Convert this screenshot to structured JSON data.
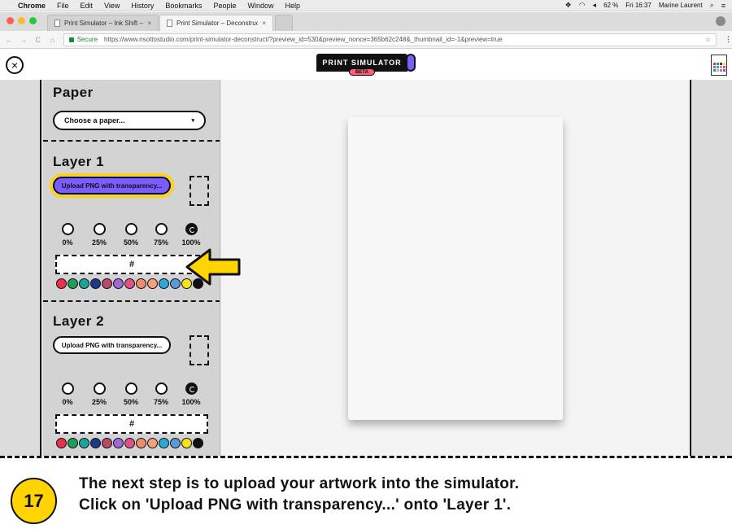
{
  "os_menubar": {
    "app": "Chrome",
    "menus": [
      "File",
      "Edit",
      "View",
      "History",
      "Bookmarks",
      "People",
      "Window",
      "Help"
    ],
    "battery": "62 %",
    "clock": "Fri 16:37",
    "user": "Marine Laurent"
  },
  "browser": {
    "tabs": [
      {
        "title": "Print Simulator – Ink Shift – Ri",
        "close": "×"
      },
      {
        "title": "Print Simulator – Deconstruct",
        "close": "×"
      }
    ],
    "secure_label": "Secure",
    "url": "https://www.risottostudio.com/print-simulator-deconstruct/?preview_id=530&preview_nonce=365b62c248&_thumbnail_id=-1&preview=true",
    "nav": {
      "back": "←",
      "forward": "→",
      "reload": "C",
      "home": "⌂"
    },
    "star": "☆",
    "menu": "⋮"
  },
  "app_header": {
    "close_glyph": "×",
    "logo_title": "PRINT SIMULATOR",
    "logo_badge": "BETA"
  },
  "sidebar": {
    "paper": {
      "title": "Paper",
      "select_value": "Choose a paper...",
      "chevron": "▾"
    },
    "layers": [
      {
        "title": "Layer 1",
        "upload_label": "Upload PNG with transparency...",
        "opacity_options": [
          "0%",
          "25%",
          "50%",
          "75%",
          "100%"
        ],
        "selected_opacity": "100%",
        "hex_placeholder": "#"
      },
      {
        "title": "Layer 2",
        "upload_label": "Upload PNG with transparency...",
        "opacity_options": [
          "0%",
          "25%",
          "50%",
          "75%",
          "100%"
        ],
        "selected_opacity": "100%",
        "hex_placeholder": "#"
      }
    ],
    "ink_colors": [
      "#e8324b",
      "#1f9e5a",
      "#1aa39a",
      "#1d3a8a",
      "#b54a6a",
      "#9b6ad6",
      "#e34f8a",
      "#ef8c6b",
      "#f4a07a",
      "#2aa8d8",
      "#5a9ad8",
      "#f5e21a",
      "#111111"
    ]
  },
  "instruction": {
    "step_number": "17",
    "line1": "The next step is to upload your artwork into the simulator.",
    "line2": "Click on 'Upload PNG with transparency...' onto 'Layer 1'."
  },
  "colors": {
    "accent_purple": "#7b5cff",
    "highlight_yellow": "#ffd400"
  }
}
